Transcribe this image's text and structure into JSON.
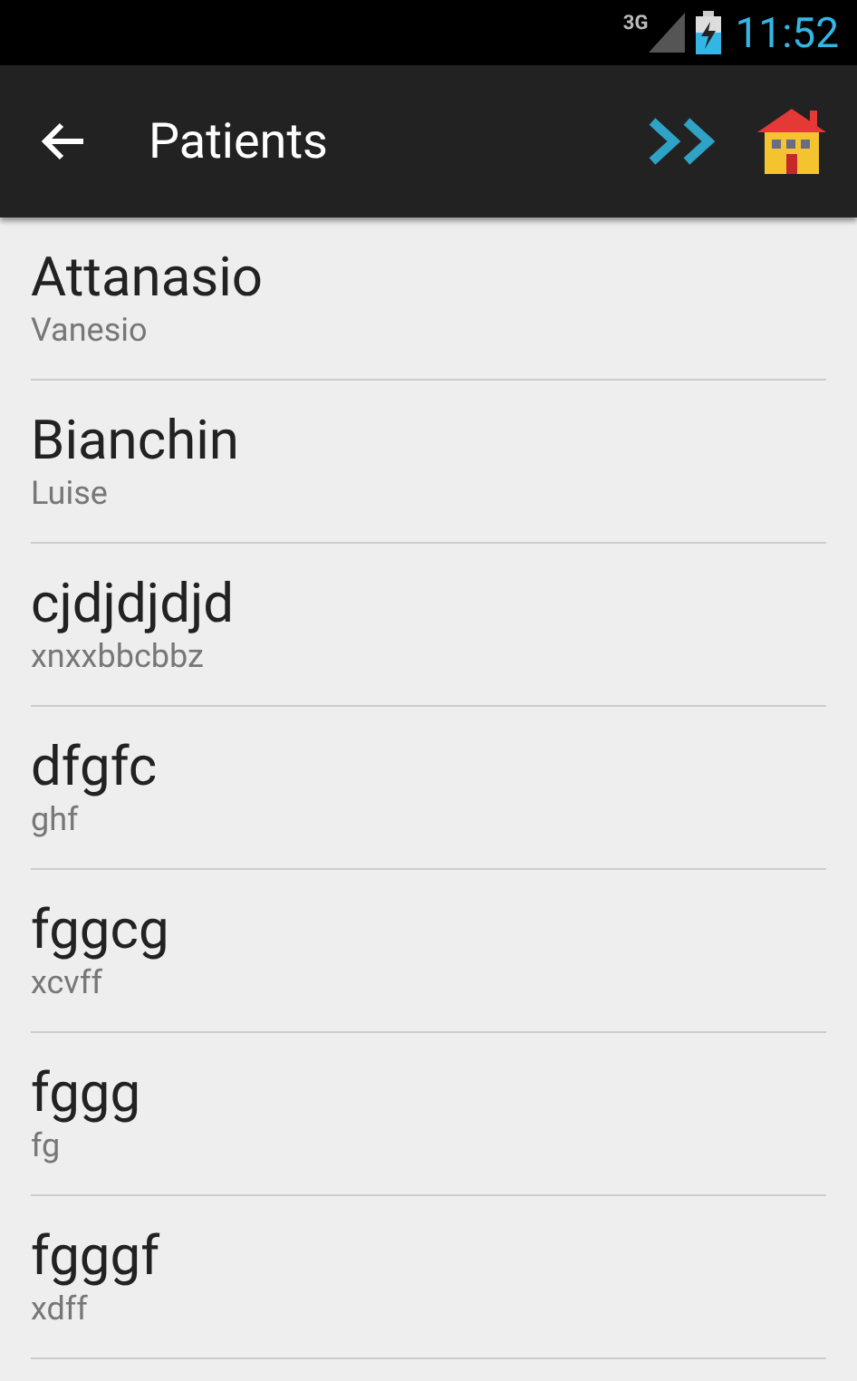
{
  "status_bar": {
    "network": "3G",
    "time": "11:52"
  },
  "action_bar": {
    "title": "Patients"
  },
  "patients": [
    {
      "name": "Attanasio",
      "subtitle": "Vanesio"
    },
    {
      "name": "Bianchin",
      "subtitle": "Luise"
    },
    {
      "name": "cjdjdjdjd",
      "subtitle": "xnxxbbcbbz"
    },
    {
      "name": "dfgfc",
      "subtitle": "ghf"
    },
    {
      "name": "fggcg",
      "subtitle": "xcvff"
    },
    {
      "name": "fggg",
      "subtitle": "fg"
    },
    {
      "name": "fgggf",
      "subtitle": "xdff"
    }
  ]
}
